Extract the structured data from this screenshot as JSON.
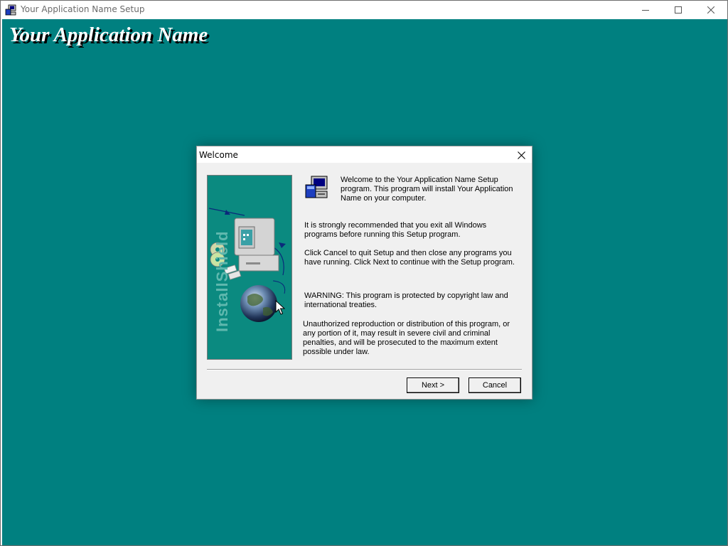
{
  "window": {
    "title": "Your Application Name Setup"
  },
  "banner": {
    "title": "Your Application Name"
  },
  "dialog": {
    "title": "Welcome",
    "intro": "Welcome to the Your Application Name Setup program.  This program will install Your Application Name on your computer.",
    "recommend": "It is strongly recommended that you exit all Windows programs before running this Setup program.",
    "instructions": "Click Cancel to quit Setup and then close any programs you have running.  Click Next to continue with the Setup program.",
    "warning": "WARNING: This program is protected by copyright law and international treaties.",
    "legal": "Unauthorized reproduction or distribution of this program, or any portion of it, may result in severe civil and criminal penalties, and will be prosecuted to the maximum extent possible under law.",
    "side_brand": "InstallShield",
    "next_label": "Next >",
    "cancel_label": "Cancel"
  },
  "colors": {
    "desktop": "#008080",
    "side_panel": "#0b8a80",
    "dialog_bg": "#f0f0f0"
  },
  "icons": {
    "app": "setup-computer-icon",
    "setup": "setup-computer-icon",
    "minimize": "minimize-icon",
    "maximize": "maximize-icon",
    "close": "close-icon"
  }
}
